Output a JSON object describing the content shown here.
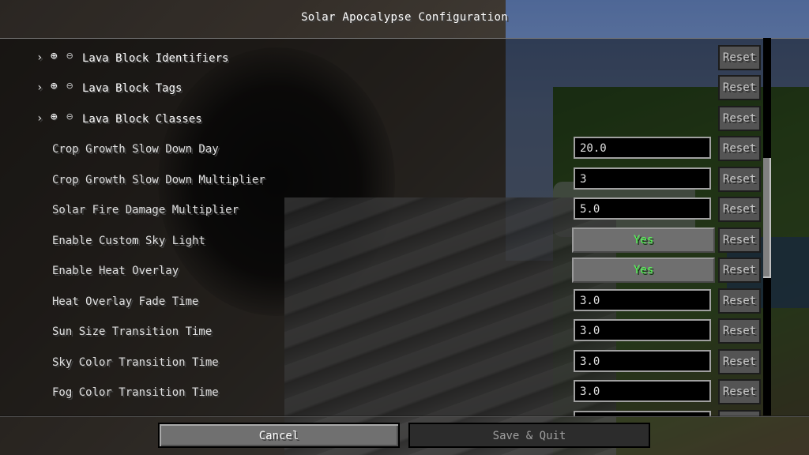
{
  "window": {
    "title": "Solar Apocalypse Configuration"
  },
  "icons": {
    "expand": "chevron-right-icon",
    "add": "add-circle-icon",
    "remove": "remove-circle-icon"
  },
  "colors": {
    "toggle_on": "#55ff55",
    "disabled_text": "#a0a0a0"
  },
  "list": {
    "groups": [
      {
        "expand_symbol": "›",
        "add_symbol": "⊕",
        "remove_symbol": "⊖",
        "label": "Lava Block Identifiers",
        "reset_label": "Reset"
      },
      {
        "expand_symbol": "›",
        "add_symbol": "⊕",
        "remove_symbol": "⊖",
        "label": "Lava Block Tags",
        "reset_label": "Reset"
      },
      {
        "expand_symbol": "›",
        "add_symbol": "⊕",
        "remove_symbol": "⊖",
        "label": "Lava Block Classes",
        "reset_label": "Reset"
      }
    ],
    "fields": [
      {
        "label": "Crop Growth Slow Down Day",
        "value": "20.0",
        "reset_label": "Reset"
      },
      {
        "label": "Crop Growth Slow Down Multiplier",
        "value": "3",
        "reset_label": "Reset"
      },
      {
        "label": "Solar Fire Damage Multiplier",
        "value": "5.0",
        "reset_label": "Reset"
      }
    ],
    "toggles": [
      {
        "label": "Enable Custom Sky Light",
        "value": "Yes",
        "reset_label": "Reset"
      },
      {
        "label": "Enable Heat Overlay",
        "value": "Yes",
        "reset_label": "Reset"
      }
    ],
    "times": [
      {
        "label": "Heat Overlay Fade Time",
        "value": "3.0",
        "reset_label": "Reset"
      },
      {
        "label": "Sun Size Transition Time",
        "value": "3.0",
        "reset_label": "Reset"
      },
      {
        "label": "Sky Color Transition Time",
        "value": "3.0",
        "reset_label": "Reset"
      },
      {
        "label": "Fog Color Transition Time",
        "value": "3.0",
        "reset_label": "Reset"
      }
    ]
  },
  "footer": {
    "cancel_label": "Cancel",
    "save_label": "Save & Quit"
  }
}
